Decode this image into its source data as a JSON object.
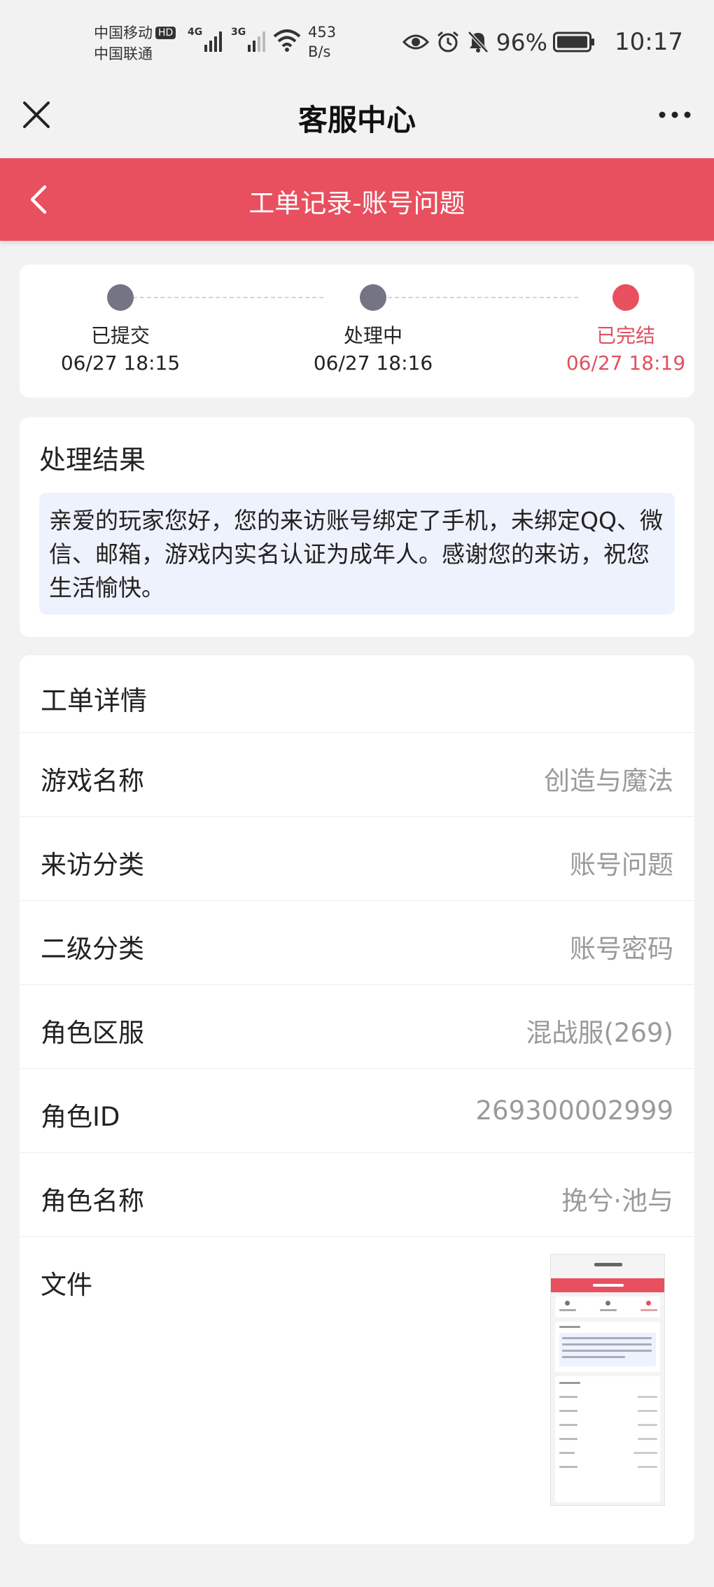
{
  "status_bar": {
    "carrier1": "中国移动",
    "hd_badge": "HD",
    "carrier2": "中国联通",
    "net1": "4G",
    "net2": "3G",
    "net_speed_value": "453",
    "net_speed_unit": "B/s",
    "battery_percent": "96%",
    "time": "10:17"
  },
  "header": {
    "title": "客服中心"
  },
  "sub_header": {
    "title": "工单记录-账号问题"
  },
  "progress": {
    "steps": [
      {
        "label": "已提交",
        "time": "06/27 18:15"
      },
      {
        "label": "处理中",
        "time": "06/27 18:16"
      },
      {
        "label": "已完结",
        "time": "06/27 18:19"
      }
    ]
  },
  "result": {
    "title": "处理结果",
    "text": "亲爱的玩家您好，您的来访账号绑定了手机，未绑定QQ、微信、邮箱，游戏内实名认证为成年人。感谢您的来访，祝您生活愉快。"
  },
  "details": {
    "title": "工单详情",
    "rows": [
      {
        "key": "游戏名称",
        "value": "创造与魔法"
      },
      {
        "key": "来访分类",
        "value": "账号问题"
      },
      {
        "key": "二级分类",
        "value": "账号密码"
      },
      {
        "key": "角色区服",
        "value": "混战服(269)"
      },
      {
        "key": "角色ID",
        "value": "269300002999"
      },
      {
        "key": "角色名称",
        "value": "挽兮·池与"
      }
    ],
    "file_label": "文件"
  },
  "colors": {
    "accent": "#e8505f",
    "page_bg": "#f2f2f2",
    "result_bg": "#eef2fd",
    "step_pending": "#747483"
  }
}
